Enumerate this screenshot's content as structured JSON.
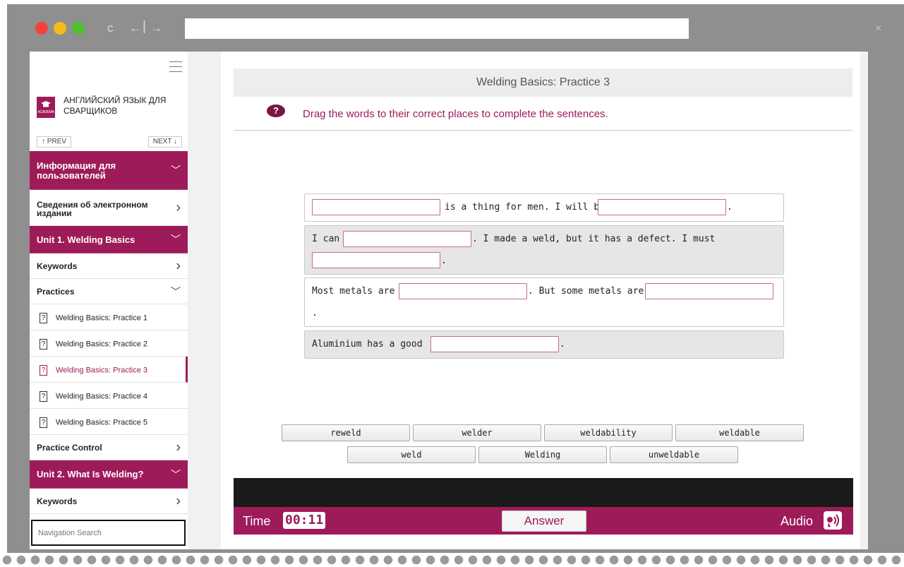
{
  "browser": {
    "url": "",
    "close_glyph": "×",
    "reload_glyph": "c",
    "back_glyph": "←",
    "forward_glyph": "→",
    "separator_glyph": "|"
  },
  "sidebar": {
    "logo_text": "ACADEMA",
    "brand_title": "АНГЛИЙСКИЙ ЯЗЫК ДЛЯ СВАРЩИКОВ",
    "prev_label": "↑ PREV",
    "next_label": "NEXT ↓",
    "chevron_down": "﹀",
    "chevron_right": "›",
    "items": {
      "info": "Информация для пользователей",
      "svedeniya": "Сведения об электронном издании",
      "unit1": "Unit 1. Welding Basics",
      "keywords1": "Keywords",
      "practices": "Practices",
      "practice1": "Welding Basics: Practice 1",
      "practice2": "Welding Basics: Practice 2",
      "practice3": "Welding Basics: Practice 3",
      "practice4": "Welding Basics: Practice 4",
      "practice5": "Welding Basics: Practice 5",
      "practice_control": "Practice Control",
      "unit2": "Unit 2. What Is Welding?",
      "keywords2": "Keywords"
    },
    "question_glyph": "?",
    "search_placeholder": "Navigation Search"
  },
  "exercise": {
    "title": "Welding Basics: Practice 3",
    "question_glyph": "?",
    "instruction": "Drag the words to their correct places to complete the sentences.",
    "sentences": {
      "s1_a": "is a thing for men. I will be a",
      "s1_b": ".",
      "s2_a": "I can",
      "s2_b": ". I made a weld, but it has a defect. I must",
      "s2_c": ".",
      "s3_a": "Most metals are",
      "s3_b": ". But some metals are",
      "s3_c": ".",
      "s4_a": "Aluminium has a good",
      "s4_b": "."
    },
    "word_bank": {
      "w1": "reweld",
      "w2": "welder",
      "w3": "weldability",
      "w4": "weldable",
      "w5": "weld",
      "w6": "Welding",
      "w7": "unweldable"
    }
  },
  "footer": {
    "time_label": "Time",
    "time_value": "00:11",
    "answer_label": "Answer",
    "audio_label": "Audio"
  },
  "colors": {
    "accent": "#9e1b59",
    "frame": "#8f8f8f"
  }
}
